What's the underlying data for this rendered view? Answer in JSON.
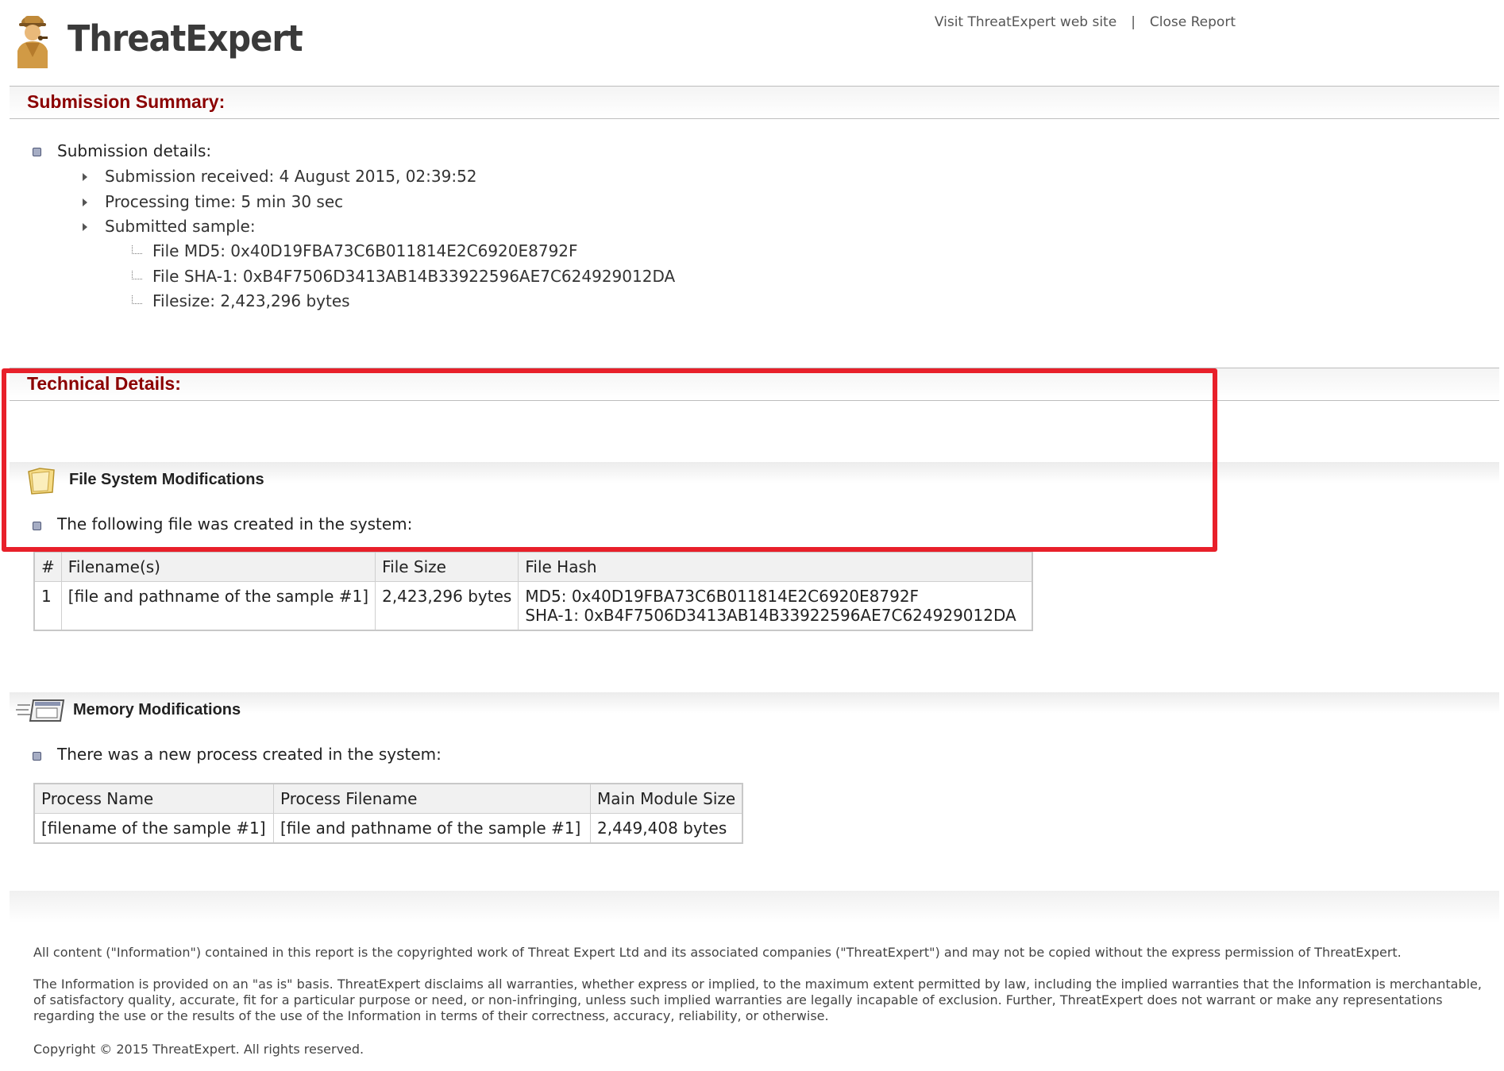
{
  "header": {
    "brand": "ThreatExpert",
    "links": [
      "Visit ThreatExpert web site",
      "Close Report"
    ],
    "separator": "|"
  },
  "submission_summary": {
    "title": "Submission Summary:",
    "details_label": "Submission details:",
    "received": "Submission received: 4 August 2015, 02:39:52",
    "processing_time": "Processing time: 5 min 30 sec",
    "sample_label": "Submitted sample:",
    "md5": "File MD5: 0x40D19FBA73C6B011814E2C6920E8792F",
    "sha1": "File SHA-1: 0xB4F7506D3413AB14B33922596AE7C624929012DA",
    "filesize": "Filesize: 2,423,296 bytes"
  },
  "technical_details": {
    "title": "Technical Details:"
  },
  "file_system": {
    "title": "File System Modifications",
    "bullet": "The following file was created in the system:",
    "columns": [
      "#",
      "Filename(s)",
      "File Size",
      "File Hash"
    ],
    "rows": [
      {
        "num": "1",
        "filename": "[file and pathname of the sample #1]",
        "size": "2,423,296 bytes",
        "md5": "MD5: 0x40D19FBA73C6B011814E2C6920E8792F",
        "sha1": "SHA-1: 0xB4F7506D3413AB14B33922596AE7C624929012DA"
      }
    ]
  },
  "memory": {
    "title": "Memory Modifications",
    "bullet": "There was a new process created in the system:",
    "columns": [
      "Process Name",
      "Process Filename",
      "Main Module Size"
    ],
    "rows": [
      {
        "name": "[filename of the sample #1]",
        "filename": "[file and pathname of the sample #1]",
        "size": "2,449,408 bytes"
      }
    ]
  },
  "footer": {
    "p1": "All content (\"Information\") contained in this report is the copyrighted work of Threat Expert Ltd and its associated companies (\"ThreatExpert\") and may not be copied without the express permission of ThreatExpert.",
    "p2": "The Information is provided on an \"as is\" basis. ThreatExpert disclaims all warranties, whether express or implied, to the maximum extent permitted by law, including the implied warranties that the Information is merchantable, of satisfactory quality, accurate, fit for a particular purpose or need, or non-infringing, unless such implied warranties are legally incapable of exclusion. Further, ThreatExpert does not warrant or make any representations regarding the use or the results of the use of the Information in terms of their correctness, accuracy, reliability, or otherwise.",
    "copyright": "Copyright © 2015 ThreatExpert. All rights reserved."
  },
  "colors": {
    "section_title": "#8b0000",
    "highlight": "#e8202a",
    "bullet": "#a6adc4"
  }
}
